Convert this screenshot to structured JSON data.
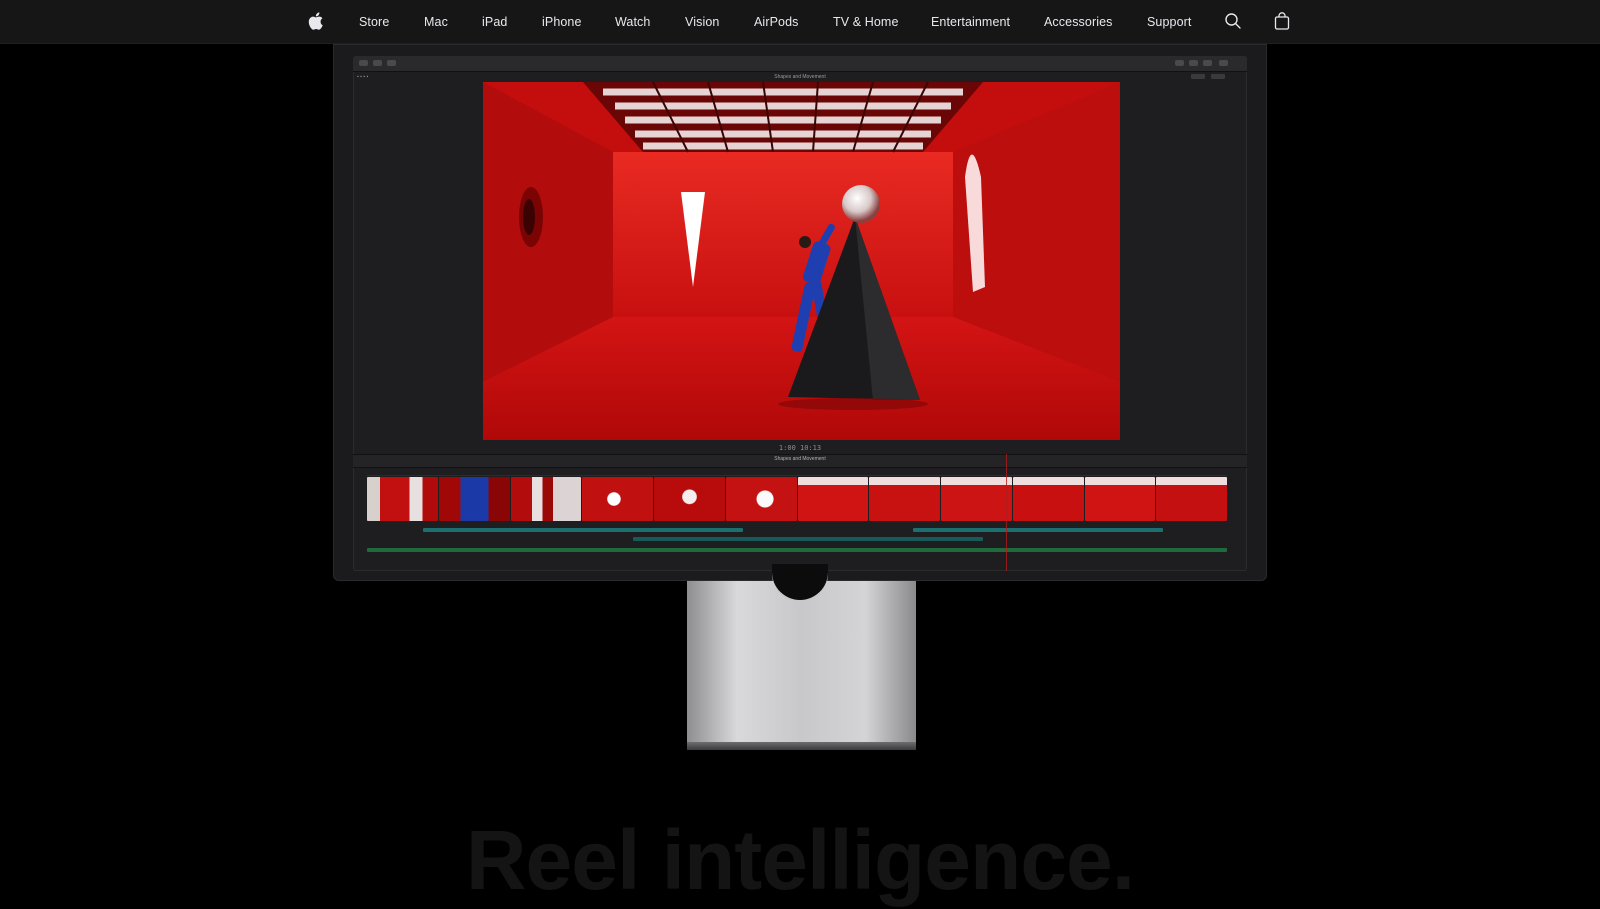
{
  "nav": {
    "apple_logo_icon": "apple-logo-icon",
    "items": [
      {
        "label": "Store"
      },
      {
        "label": "Mac"
      },
      {
        "label": "iPad"
      },
      {
        "label": "iPhone"
      },
      {
        "label": "Watch"
      },
      {
        "label": "Vision"
      },
      {
        "label": "AirPods"
      },
      {
        "label": "TV & Home"
      },
      {
        "label": "Entertainment"
      },
      {
        "label": "Accessories"
      },
      {
        "label": "Support"
      }
    ],
    "search_icon": "search-icon",
    "bag_icon": "bag-icon"
  },
  "app": {
    "project_title": "Shapes and Movement",
    "timecode": "1:00 10:13",
    "timeline_project": "Shapes and Movement"
  },
  "headline": "Reel intelligence.",
  "colors": {
    "nav_bg": "#161617",
    "page_bg": "#000000",
    "viewer_red": "#c40d0d",
    "headline": "#141414"
  }
}
